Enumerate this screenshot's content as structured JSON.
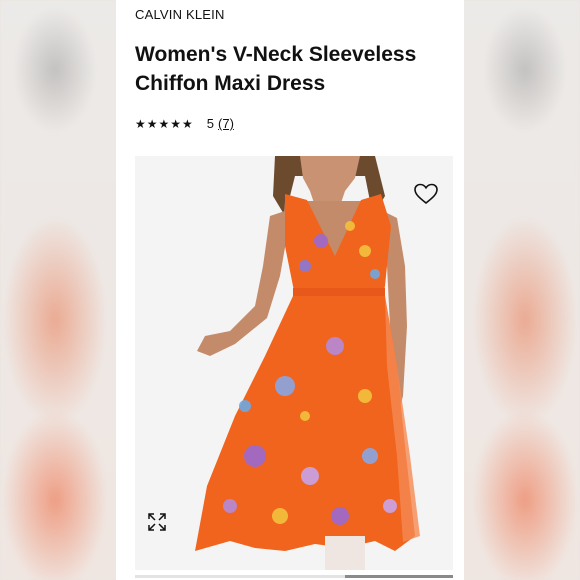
{
  "product": {
    "brand": "CALVIN KLEIN",
    "title": "Women's V-Neck Sleeveless Chiffon Maxi Dress",
    "rating": {
      "stars": "★★★★★",
      "value": "5",
      "count": "(7)"
    }
  },
  "gallery": {
    "image_subject": "orange-floral-maxi-dress",
    "wishlist_icon": "heart-outline-icon",
    "zoom_icon": "expand-arrows-icon"
  },
  "colors": {
    "dress_orange": "#f0641e",
    "text": "#111111",
    "background": "#ffffff"
  }
}
